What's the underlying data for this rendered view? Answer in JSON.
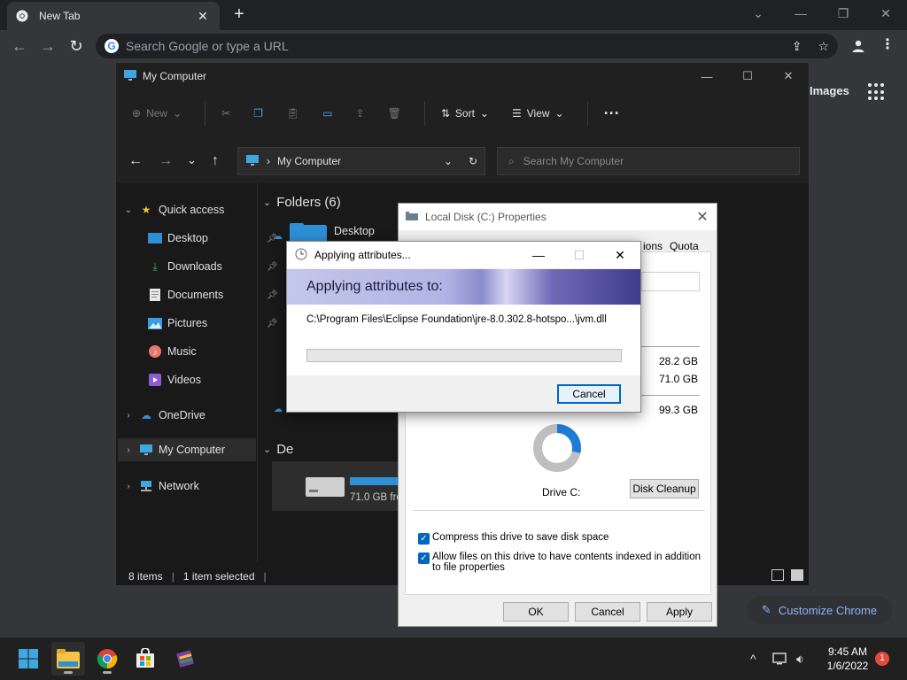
{
  "chrome": {
    "tab_title": "New Tab",
    "omnibox_placeholder": "Search Google or type a URL",
    "ntp_images": "Images",
    "customize_label": "Customize Chrome"
  },
  "explorer": {
    "title": "My Computer",
    "toolbar": {
      "new": "New",
      "sort": "Sort",
      "view": "View"
    },
    "address": "My Computer",
    "search_placeholder": "Search My Computer",
    "sidebar": {
      "quick_access": "Quick access",
      "items": [
        {
          "label": "Desktop",
          "icon": "desktop-icon"
        },
        {
          "label": "Downloads",
          "icon": "downloads-icon"
        },
        {
          "label": "Documents",
          "icon": "documents-icon"
        },
        {
          "label": "Pictures",
          "icon": "pictures-icon"
        },
        {
          "label": "Music",
          "icon": "music-icon"
        },
        {
          "label": "Videos",
          "icon": "videos-icon"
        }
      ],
      "onedrive": "OneDrive",
      "my_computer": "My Computer",
      "network": "Network"
    },
    "folders_header": "Folders (6)",
    "folder_desktop": "Desktop",
    "devices_header_partial": "De",
    "drive_free": "71.0 GB fre",
    "status_items": "8 items",
    "status_selected": "1 item selected"
  },
  "properties": {
    "title": "Local Disk (C:) Properties",
    "tab_partial": "ions",
    "tab_quota": "Quota",
    "used": "28.2 GB",
    "free": "71.0 GB",
    "capacity": "99.3 GB",
    "drive_label": "Drive C:",
    "cleanup": "Disk Cleanup",
    "compress": "Compress this drive to save disk space",
    "index": "Allow files on this drive to have contents indexed in addition to file properties",
    "ok": "OK",
    "cancel": "Cancel",
    "apply": "Apply",
    "colors": {
      "used": "#1e7bd8",
      "free": "#bfbfbf"
    }
  },
  "applying": {
    "title": "Applying attributes...",
    "banner": "Applying attributes to:",
    "path": "C:\\Program Files\\Eclipse Foundation\\jre-8.0.302.8-hotspo...\\jvm.dll",
    "cancel": "Cancel",
    "progress": 0
  },
  "taskbar": {
    "time": "9:45 AM",
    "date": "1/6/2022",
    "notifications": "1"
  }
}
